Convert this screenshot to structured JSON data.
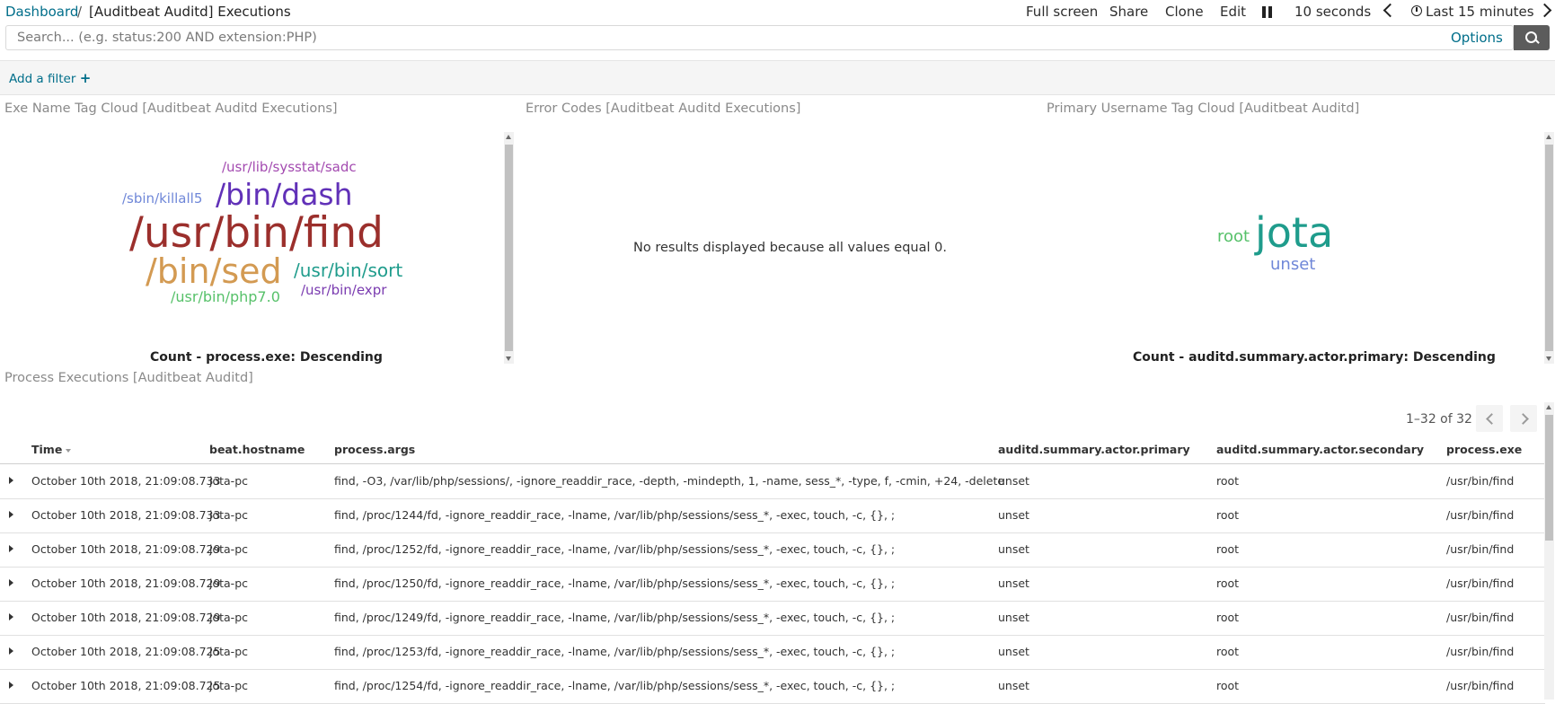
{
  "breadcrumb": {
    "root": "Dashboard",
    "separator": "/",
    "title": "[Auditbeat Auditd] Executions"
  },
  "menu": {
    "full_screen": "Full screen",
    "share": "Share",
    "clone": "Clone",
    "edit": "Edit",
    "refresh_interval": "10 seconds",
    "time_range": "Last 15 minutes"
  },
  "search": {
    "placeholder": "Search... (e.g. status:200 AND extension:PHP)",
    "value": "",
    "options_label": "Options"
  },
  "filter": {
    "add_label": "Add a filter",
    "plus": "+"
  },
  "panels": {
    "exe_cloud": {
      "title": "Exe Name Tag Cloud [Auditbeat Auditd Executions]",
      "tags": [
        {
          "text": "/usr/lib/sysstat/sadc",
          "color": "#a34ab0"
        },
        {
          "text": "/sbin/killall5",
          "color": "#6f87d8"
        },
        {
          "text": "/bin/dash",
          "color": "#6131b8"
        },
        {
          "text": "/usr/bin/find",
          "color": "#9b2f2c"
        },
        {
          "text": "/bin/sed",
          "color": "#d39a52"
        },
        {
          "text": "/usr/bin/sort",
          "color": "#1f9c8c"
        },
        {
          "text": "/usr/bin/php7.0",
          "color": "#57c16a"
        },
        {
          "text": "/usr/bin/expr",
          "color": "#7a3bb0"
        }
      ],
      "legend": "Count - process.exe: Descending"
    },
    "error_codes": {
      "title": "Error Codes [Auditbeat Auditd Executions]",
      "message": "No results displayed because all values equal 0."
    },
    "username_cloud": {
      "title": "Primary Username Tag Cloud [Auditbeat Auditd]",
      "tags": [
        {
          "text": "root",
          "color": "#57c16a"
        },
        {
          "text": "jota",
          "color": "#1f9c8c"
        },
        {
          "text": "unset",
          "color": "#6f87d8"
        }
      ],
      "legend": "Count - auditd.summary.actor.primary: Descending"
    },
    "process_table": {
      "title": "Process Executions [Auditbeat Auditd]",
      "pagination": "1–32 of 32",
      "columns": [
        "Time",
        "beat.hostname",
        "process.args",
        "auditd.summary.actor.primary",
        "auditd.summary.actor.secondary",
        "process.exe"
      ],
      "rows": [
        [
          "October 10th 2018, 21:09:08.733",
          "jota-pc",
          "find, -O3, /var/lib/php/sessions/, -ignore_readdir_race, -depth, -mindepth, 1, -name, sess_*, -type, f, -cmin, +24, -delete",
          "unset",
          "root",
          "/usr/bin/find"
        ],
        [
          "October 10th 2018, 21:09:08.733",
          "jota-pc",
          "find, /proc/1244/fd, -ignore_readdir_race, -lname, /var/lib/php/sessions/sess_*, -exec, touch, -c, {}, ;",
          "unset",
          "root",
          "/usr/bin/find"
        ],
        [
          "October 10th 2018, 21:09:08.729",
          "jota-pc",
          "find, /proc/1252/fd, -ignore_readdir_race, -lname, /var/lib/php/sessions/sess_*, -exec, touch, -c, {}, ;",
          "unset",
          "root",
          "/usr/bin/find"
        ],
        [
          "October 10th 2018, 21:09:08.729",
          "jota-pc",
          "find, /proc/1250/fd, -ignore_readdir_race, -lname, /var/lib/php/sessions/sess_*, -exec, touch, -c, {}, ;",
          "unset",
          "root",
          "/usr/bin/find"
        ],
        [
          "October 10th 2018, 21:09:08.729",
          "jota-pc",
          "find, /proc/1249/fd, -ignore_readdir_race, -lname, /var/lib/php/sessions/sess_*, -exec, touch, -c, {}, ;",
          "unset",
          "root",
          "/usr/bin/find"
        ],
        [
          "October 10th 2018, 21:09:08.725",
          "jota-pc",
          "find, /proc/1253/fd, -ignore_readdir_race, -lname, /var/lib/php/sessions/sess_*, -exec, touch, -c, {}, ;",
          "unset",
          "root",
          "/usr/bin/find"
        ],
        [
          "October 10th 2018, 21:09:08.725",
          "jota-pc",
          "find, /proc/1254/fd, -ignore_readdir_race, -lname, /var/lib/php/sessions/sess_*, -exec, touch, -c, {}, ;",
          "unset",
          "root",
          "/usr/bin/find"
        ]
      ]
    }
  },
  "colors": {
    "link": "#006e8a",
    "search_button": "#5c5c5c"
  },
  "icons": {
    "pause": "pause-icon",
    "previous": "chevron-left-icon",
    "next": "chevron-right-icon",
    "clock": "clock-icon",
    "search": "search-icon",
    "row_expand": "caret-right-icon"
  }
}
